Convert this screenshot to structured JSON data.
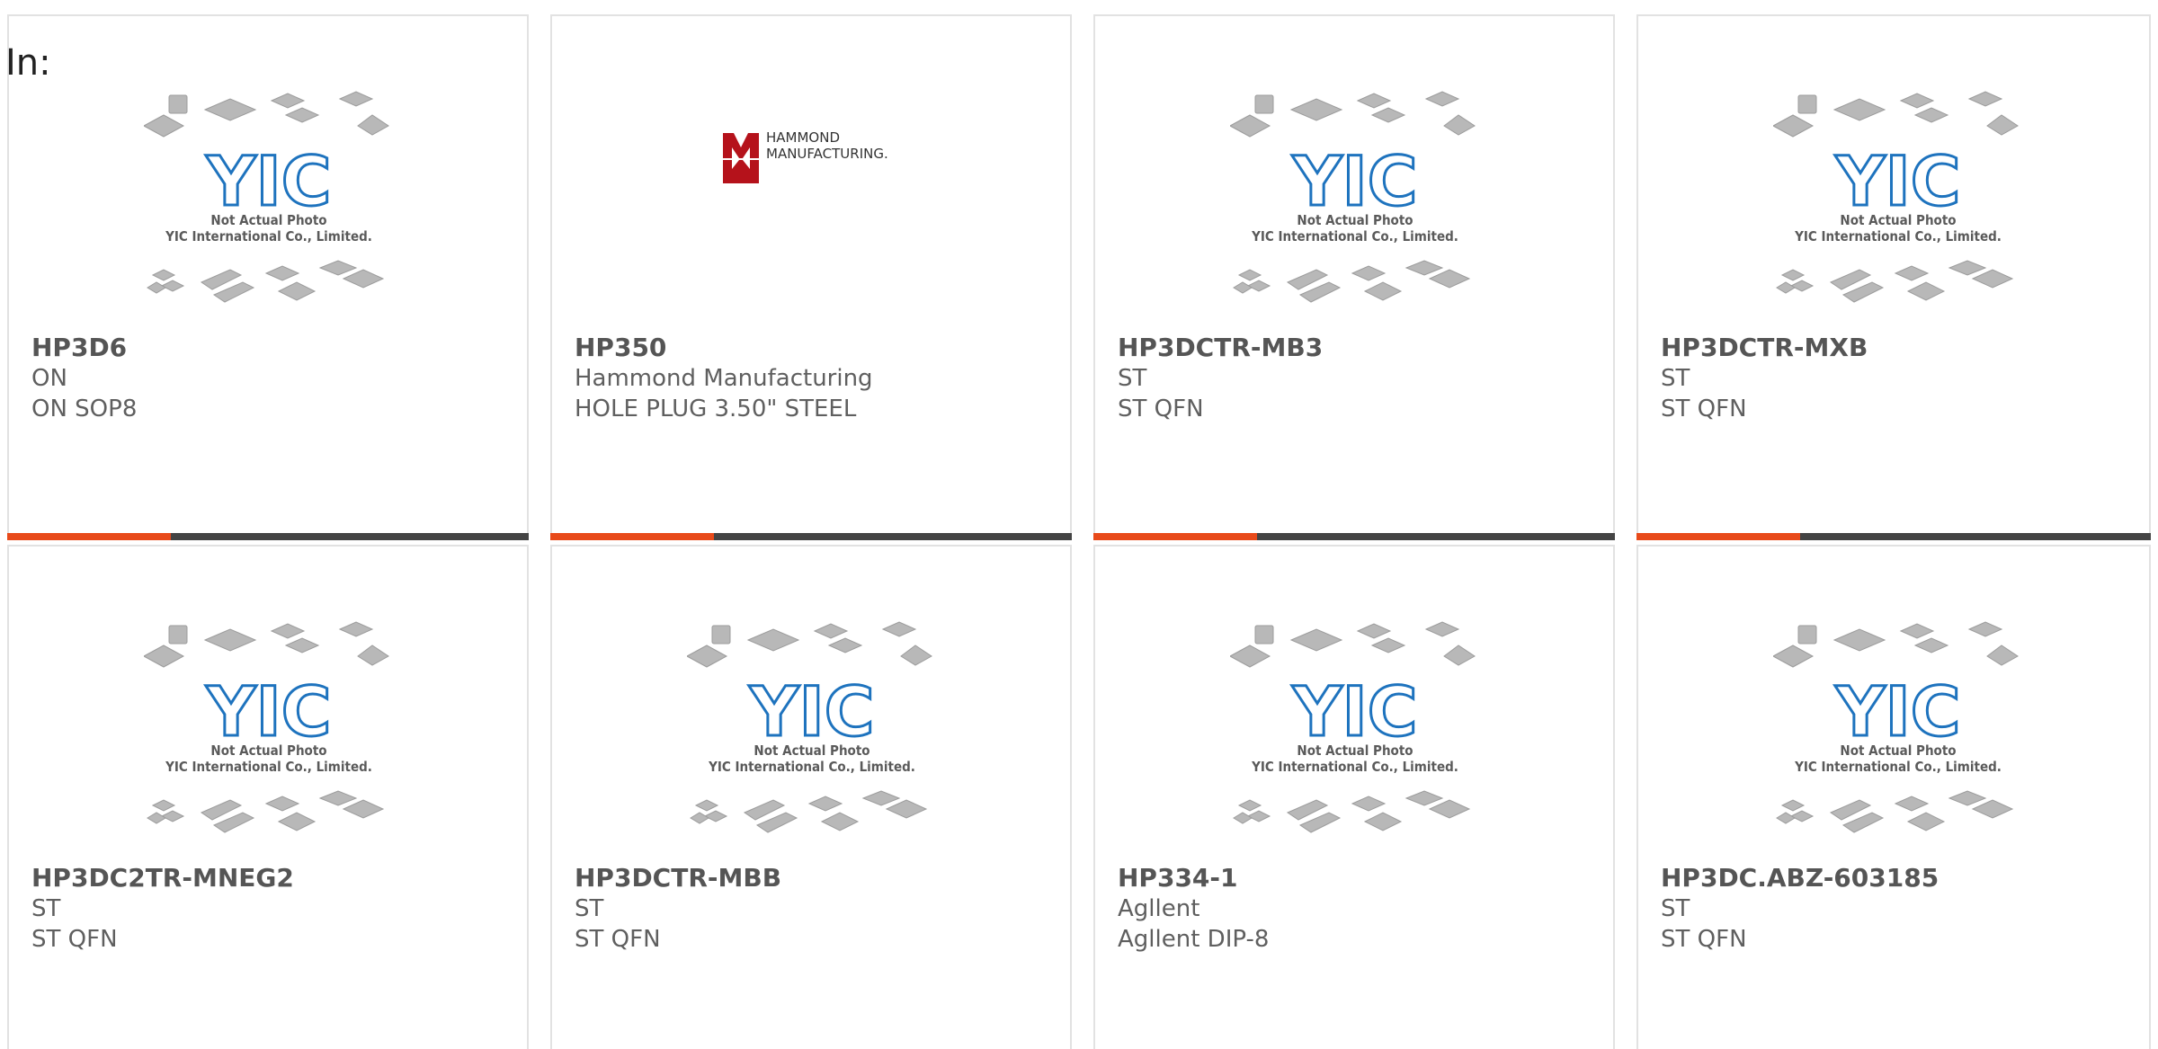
{
  "page": {
    "prefix_label": "In:"
  },
  "placeholder": {
    "caption_line1": "Not Actual Photo",
    "caption_line2": "YIC International Co., Limited.",
    "logo_text": "YIC"
  },
  "hammond_logo": {
    "line1": "HAMMOND",
    "line2": "MANUFACTURING."
  },
  "colors": {
    "accent": "#e84a1a",
    "bar": "#444444",
    "yic_blue": "#1e73be",
    "hammond_red": "#b5121b"
  },
  "products": [
    {
      "part": "HP3D6",
      "brand": "ON",
      "desc": "ON SOP8",
      "image": "yic-placeholder"
    },
    {
      "part": "HP350",
      "brand": "Hammond Manufacturing",
      "desc": "HOLE PLUG 3.50\" STEEL",
      "image": "hammond-logo"
    },
    {
      "part": "HP3DCTR-MB3",
      "brand": "ST",
      "desc": "ST QFN",
      "image": "yic-placeholder"
    },
    {
      "part": "HP3DCTR-MXB",
      "brand": "ST",
      "desc": "ST QFN",
      "image": "yic-placeholder"
    },
    {
      "part": "HP3DC2TR-MNEG2",
      "brand": "ST",
      "desc": "ST QFN",
      "image": "yic-placeholder"
    },
    {
      "part": "HP3DCTR-MBB",
      "brand": "ST",
      "desc": "ST QFN",
      "image": "yic-placeholder"
    },
    {
      "part": "HP334-1",
      "brand": "Agllent",
      "desc": "Agllent DIP-8",
      "image": "yic-placeholder"
    },
    {
      "part": "HP3DC.ABZ-603185",
      "brand": "ST",
      "desc": "ST QFN",
      "image": "yic-placeholder"
    }
  ]
}
